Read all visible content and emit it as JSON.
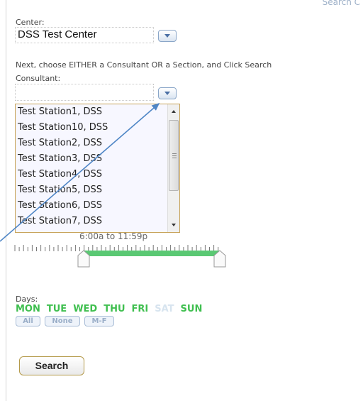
{
  "header": {
    "search_link_partial": "Search C"
  },
  "center": {
    "label": "Center:",
    "value": "DSS Test Center"
  },
  "instruction": "Next, choose EITHER a Consultant OR a Section, and Click Search",
  "consultant": {
    "label": "Consultant:",
    "value": "",
    "options": [
      "Test Station1, DSS",
      "Test Station10, DSS",
      "Test Station2, DSS",
      "Test Station3, DSS",
      "Test Station4, DSS",
      "Test Station5, DSS",
      "Test Station6, DSS",
      "Test Station7, DSS"
    ]
  },
  "time": {
    "readout": "6:00a to 11:59p"
  },
  "days": {
    "label": "Days:",
    "items": [
      {
        "label": "MON",
        "selected": true
      },
      {
        "label": "TUE",
        "selected": true
      },
      {
        "label": "WED",
        "selected": true
      },
      {
        "label": "THU",
        "selected": true
      },
      {
        "label": "FRI",
        "selected": true
      },
      {
        "label": "SAT",
        "selected": false
      },
      {
        "label": "SUN",
        "selected": true
      }
    ],
    "quick_buttons": {
      "all": "All",
      "none": "None",
      "weekdays": "M-F"
    }
  },
  "search_button": "Search",
  "colors": {
    "day_selected": "#3fbf4f",
    "day_unselected": "#d7e4ef",
    "slider_range": "#5ac873",
    "annotation_arrow": "#4f86c6"
  },
  "icons": {
    "dropdown": "chevron-down-icon",
    "scroll_up": "triangle-up-icon",
    "scroll_down": "triangle-down-icon"
  }
}
